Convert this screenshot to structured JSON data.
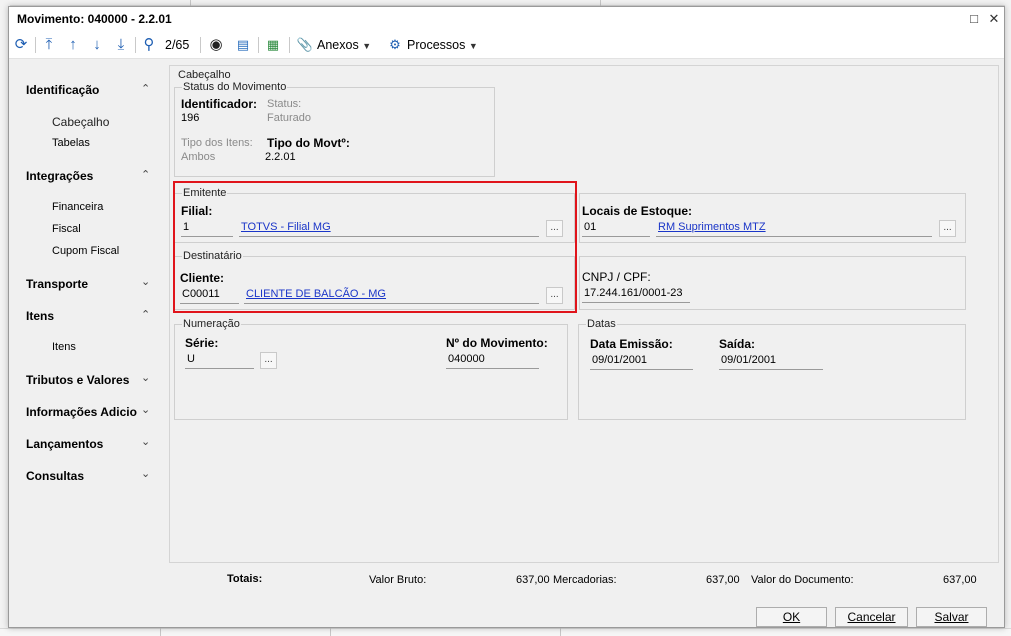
{
  "window": {
    "title": "Movimento: 040000 - 2.2.01"
  },
  "toolbar": {
    "record_counter": "2/65",
    "anexos_label": "Anexos",
    "processos_label": "Processos"
  },
  "sidebar": {
    "sections": [
      {
        "label": "Identificação",
        "expanded": true,
        "items": [
          "Cabeçalho",
          "Tabelas"
        ]
      },
      {
        "label": "Integrações",
        "expanded": true,
        "items": [
          "Financeira",
          "Fiscal",
          "Cupom Fiscal"
        ]
      },
      {
        "label": "Transporte",
        "expanded": false,
        "items": []
      },
      {
        "label": "Itens",
        "expanded": true,
        "items": [
          "Itens"
        ]
      },
      {
        "label": "Tributos e Valores",
        "expanded": false,
        "items": []
      },
      {
        "label": "Informações Adicio",
        "expanded": false,
        "items": []
      },
      {
        "label": "Lançamentos",
        "expanded": false,
        "items": []
      },
      {
        "label": "Consultas",
        "expanded": false,
        "items": []
      }
    ]
  },
  "form": {
    "cabecalho_title": "Cabeçalho",
    "status": {
      "title": "Status do Movimento",
      "identificador_label": "Identificador:",
      "identificador_value": "196",
      "status_label": "Status:",
      "status_value": "Faturado",
      "tipo_itens_label": "Tipo dos Itens:",
      "tipo_itens_value": "Ambos",
      "tipo_movto_label": "Tipo do Movtº:",
      "tipo_movto_value": "2.2.01"
    },
    "emitente": {
      "title": "Emitente",
      "filial_label": "Filial:",
      "filial_code": "1",
      "filial_name": "TOTVS - Filial MG"
    },
    "locais": {
      "label": "Locais de Estoque:",
      "code": "01",
      "name": "RM Suprimentos MTZ"
    },
    "destinatario": {
      "title": "Destinatário",
      "cliente_label": "Cliente:",
      "cliente_code": "C00011",
      "cliente_name": "CLIENTE DE BALCÃO - MG",
      "cnpj_label": "CNPJ / CPF:",
      "cnpj_value": "17.244.161/0001-23"
    },
    "numeracao": {
      "title": "Numeração",
      "serie_label": "Série:",
      "serie_value": "U",
      "numero_label": "Nº do Movimento:",
      "numero_value": "040000"
    },
    "datas": {
      "title": "Datas",
      "emissao_label": "Data Emissão:",
      "emissao_value": "09/01/2001",
      "saida_label": "Saída:",
      "saida_value": "09/01/2001"
    },
    "lookup_button": "..."
  },
  "totals": {
    "label": "Totais:",
    "valor_bruto_label": "Valor Bruto:",
    "valor_bruto_value": "637,00",
    "mercadorias_label": "Mercadorias:",
    "mercadorias_value": "637,00",
    "valor_documento_label": "Valor do Documento:",
    "valor_documento_value": "637,00"
  },
  "buttons": {
    "ok": "OK",
    "cancelar": "Cancelar",
    "salvar": "Salvar"
  },
  "colors": {
    "highlight": "#e0141b",
    "link": "#1a35c8",
    "toolbar_icon": "#1f5fb3"
  }
}
